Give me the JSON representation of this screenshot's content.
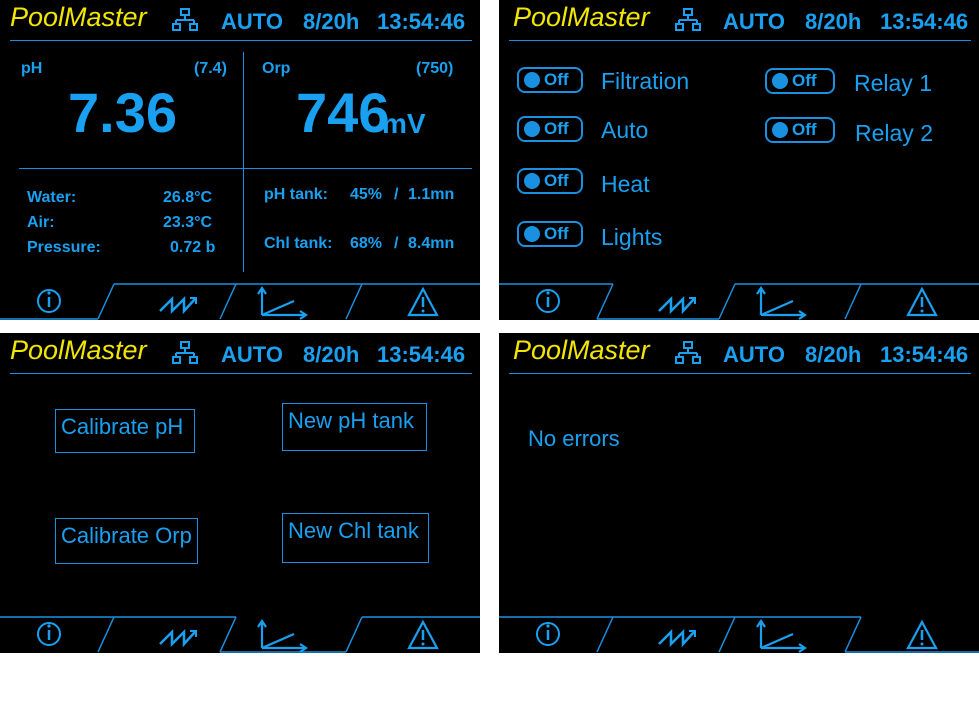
{
  "header": {
    "brand": "PoolMaster",
    "mode": "AUTO",
    "date": "8/20h",
    "time": "13:54:46",
    "network_icon": "network-icon"
  },
  "colors": {
    "accent": "#1aa0f0",
    "brand": "#f2e600",
    "background": "#000000"
  },
  "tabs": [
    {
      "name": "info",
      "icon": "info-icon"
    },
    {
      "name": "trend",
      "icon": "trend-icon"
    },
    {
      "name": "chart",
      "icon": "chart-icon"
    },
    {
      "name": "alarms",
      "icon": "warning-icon"
    }
  ],
  "screen1": {
    "ph": {
      "label": "pH",
      "setpoint": "(7.4)",
      "value": "7.36"
    },
    "orp": {
      "label": "Orp",
      "setpoint": "(750)",
      "value": "746",
      "unit": "mV"
    },
    "water": {
      "label": "Water:",
      "value": "26.8°C"
    },
    "air": {
      "label": "Air:",
      "value": "23.3°C"
    },
    "pressure": {
      "label": "Pressure:",
      "value": "0.72 b"
    },
    "ph_tank": {
      "label": "pH tank:",
      "level": "45%",
      "sep": "/",
      "time": "1.1mn"
    },
    "chl_tank": {
      "label": "Chl tank:",
      "level": "68%",
      "sep": "/",
      "time": "8.4mn"
    }
  },
  "screen2": {
    "toggles": [
      {
        "label": "Filtration",
        "state": "Off"
      },
      {
        "label": "Auto",
        "state": "Off"
      },
      {
        "label": "Heat",
        "state": "Off"
      },
      {
        "label": "Lights",
        "state": "Off"
      },
      {
        "label": "Relay 1",
        "state": "Off"
      },
      {
        "label": "Relay 2",
        "state": "Off"
      }
    ]
  },
  "screen3": {
    "calibrate_ph": "Calibrate pH",
    "calibrate_orp": "Calibrate Orp",
    "new_ph_tank": "New pH tank",
    "new_chl_tank": "New Chl tank"
  },
  "screen4": {
    "message": "No errors"
  }
}
